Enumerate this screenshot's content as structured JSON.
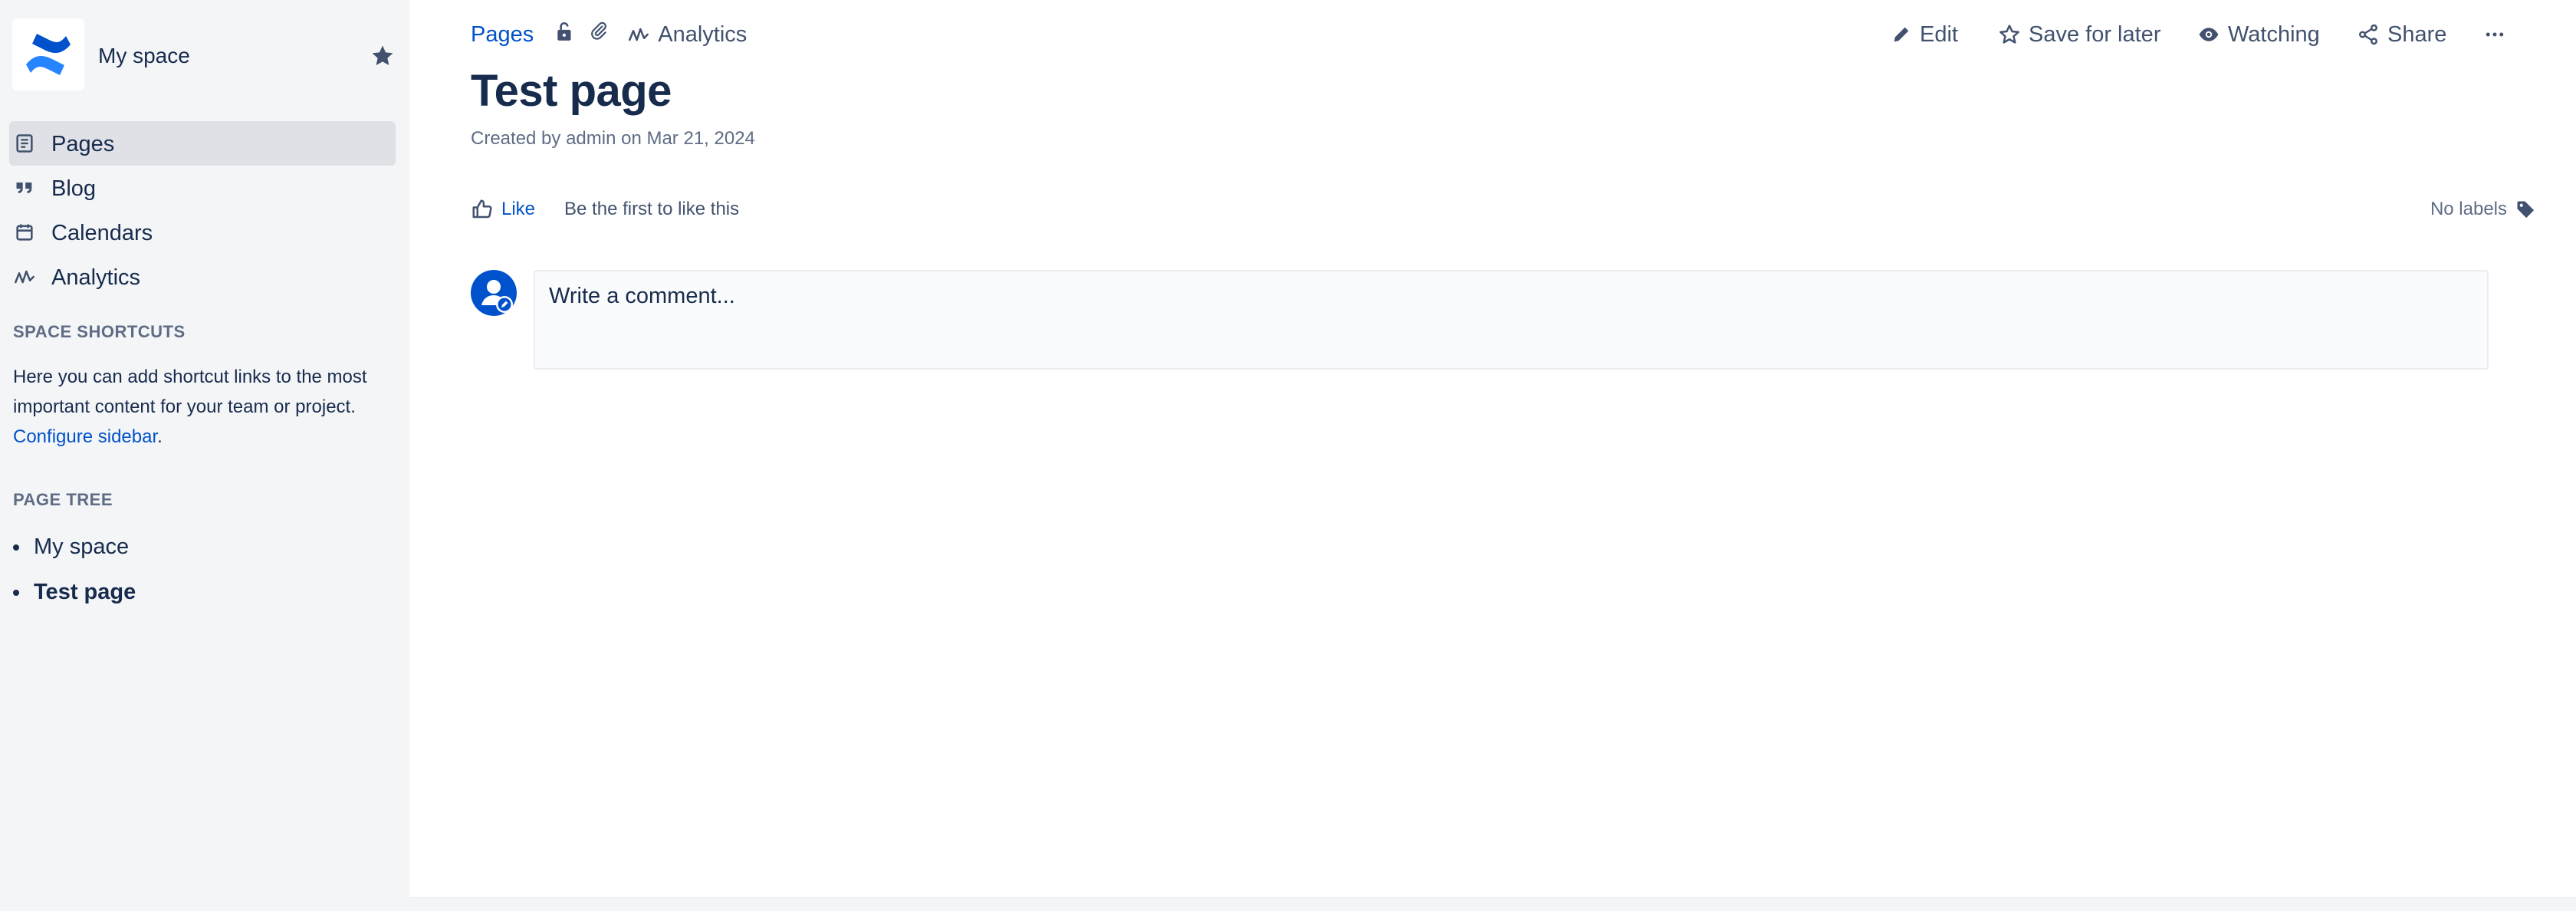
{
  "sidebar": {
    "space_name": "My space",
    "nav": [
      {
        "label": "Pages",
        "icon": "page-icon",
        "active": true
      },
      {
        "label": "Blog",
        "icon": "quote-icon",
        "active": false
      },
      {
        "label": "Calendars",
        "icon": "calendar-icon",
        "active": false
      },
      {
        "label": "Analytics",
        "icon": "analytics-icon",
        "active": false
      }
    ],
    "shortcuts": {
      "title": "SPACE SHORTCUTS",
      "text": "Here you can add shortcut links to the most important content for your team or project.",
      "link": "Configure sidebar",
      "suffix": "."
    },
    "tree": {
      "title": "PAGE TREE",
      "items": [
        {
          "label": "My space",
          "current": false
        },
        {
          "label": "Test page",
          "current": true
        }
      ]
    }
  },
  "breadcrumbs": {
    "pages": "Pages",
    "analytics": "Analytics"
  },
  "toolbar": {
    "edit": "Edit",
    "save_for_later": "Save for later",
    "watching": "Watching",
    "share": "Share"
  },
  "page": {
    "title": "Test page",
    "byline": "Created by admin on Mar 21, 2024"
  },
  "likes": {
    "like_label": "Like",
    "hint": "Be the first to like this"
  },
  "labels": {
    "text": "No labels"
  },
  "comment": {
    "placeholder": "Write a comment..."
  },
  "colors": {
    "sidebar_bg": "#f4f5f7",
    "active_nav_bg": "#dfe1e6",
    "link": "#0052cc",
    "text": "#172b4d",
    "subtle_text": "#5e6c84",
    "logo_blue": "#2684ff"
  }
}
